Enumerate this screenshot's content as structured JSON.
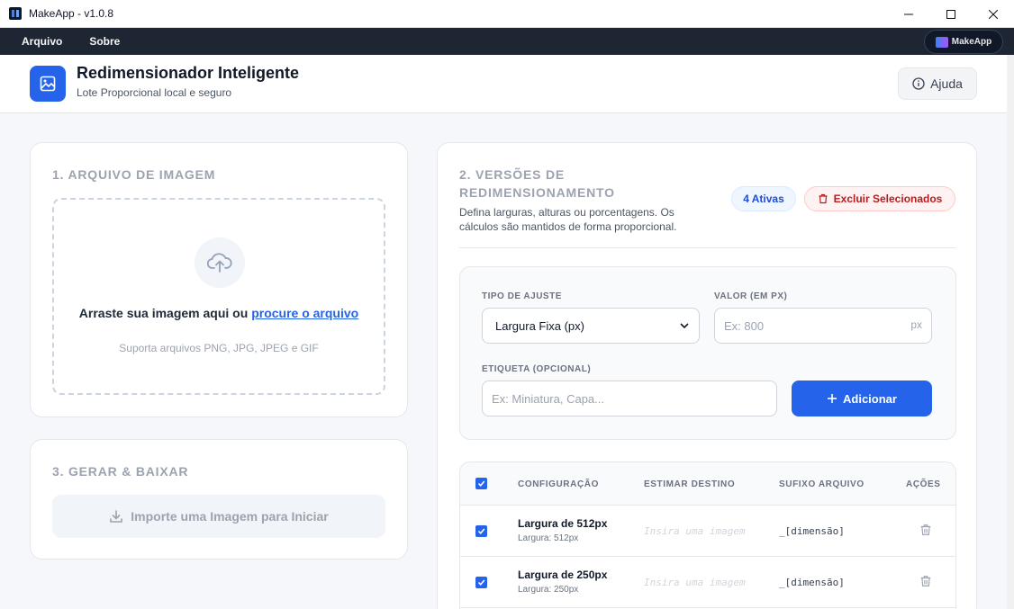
{
  "window": {
    "title": "MakeApp - v1.0.8"
  },
  "menu": {
    "items": [
      "Arquivo",
      "Sobre"
    ],
    "brand": "MakeApp"
  },
  "header": {
    "title": "Redimensionador Inteligente",
    "subtitle": "Lote Proporcional local e seguro",
    "help_label": "Ajuda"
  },
  "upload": {
    "section_title": "1. ARQUIVO DE IMAGEM",
    "drop_text": "Arraste sua imagem aqui ou ",
    "browse_link": "procure o arquivo",
    "hint": "Suporta arquivos PNG, JPG, JPEG e GIF"
  },
  "generate": {
    "section_title": "3. GERAR & BAIXAR",
    "button_label": "Importe uma Imagem para Iniciar"
  },
  "versions": {
    "section_title": "2. VERSÕES DE REDIMENSIONAMENTO",
    "description": "Defina larguras, alturas ou porcentagens. Os cálculos são mantidos de forma proporcional.",
    "active_badge": "4 Ativas",
    "delete_selected_label": "Excluir Selecionados",
    "form": {
      "type_label": "TIPO DE AJUSTE",
      "type_value": "Largura Fixa (px)",
      "value_label": "VALOR (EM PX)",
      "value_placeholder": "Ex: 800",
      "value_suffix": "px",
      "tag_label": "ETIQUETA (OPCIONAL)",
      "tag_placeholder": "Ex: Miniatura, Capa...",
      "add_label": "Adicionar"
    },
    "table": {
      "headers": [
        "CONFIGURAÇÃO",
        "ESTIMAR DESTINO",
        "SUFIXO ARQUIVO",
        "AÇÕES"
      ],
      "rows": [
        {
          "title": "Largura de 512px",
          "sub": "Largura: 512px",
          "estimate": "Insira uma imagem",
          "suffix": "_[dimensão]"
        },
        {
          "title": "Largura de 250px",
          "sub": "Largura: 250px",
          "estimate": "Insira uma imagem",
          "suffix": "_[dimensão]"
        }
      ]
    }
  }
}
